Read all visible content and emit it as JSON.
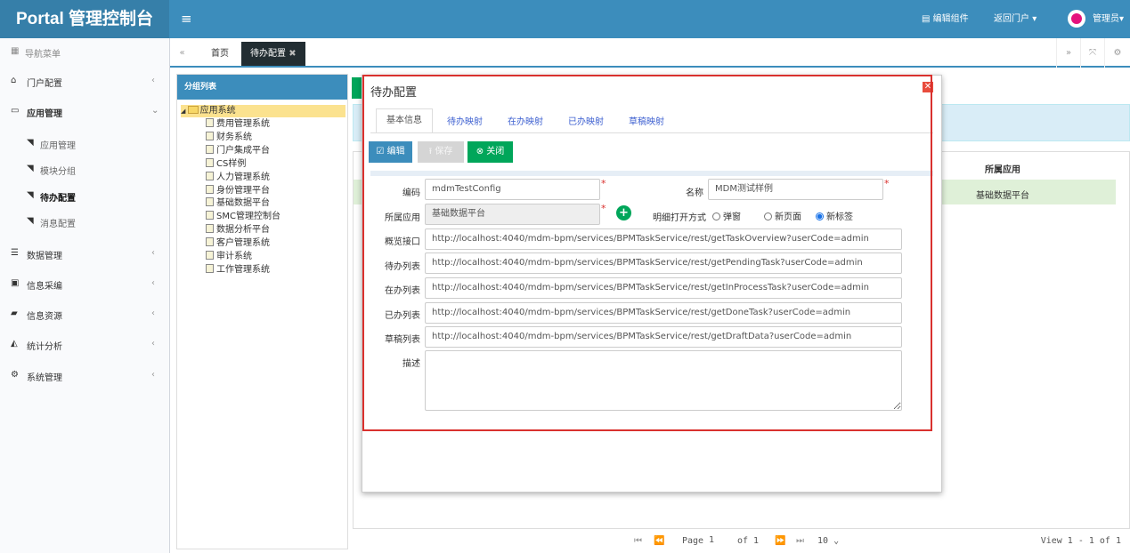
{
  "header": {
    "app_title": "Portal 管理控制台",
    "edit_widget": "编辑组件",
    "back_portal": "返回门户",
    "user": "管理员"
  },
  "sidebar": {
    "nav_title": "导航菜单",
    "items": [
      {
        "label": "门户配置"
      },
      {
        "label": "应用管理"
      },
      {
        "label": "应用管理"
      },
      {
        "label": "模块分组"
      },
      {
        "label": "待办配置"
      },
      {
        "label": "消息配置"
      },
      {
        "label": "数据管理"
      },
      {
        "label": "信息采编"
      },
      {
        "label": "信息资源"
      },
      {
        "label": "统计分析"
      },
      {
        "label": "系统管理"
      }
    ]
  },
  "tabs": {
    "home": "首页",
    "active": "待办配置"
  },
  "group_panel": {
    "title": "分组列表",
    "root": "应用系统",
    "children": [
      "费用管理系统",
      "财务系统",
      "门户集成平台",
      "CS样例",
      "人力管理系统",
      "身份管理平台",
      "基础数据平台",
      "SMC管理控制台",
      "数据分析平台",
      "客户管理系统",
      "审计系统",
      "工作管理系统"
    ]
  },
  "table": {
    "header_app": "所属应用",
    "row_app": "基础数据平台"
  },
  "pager": {
    "page_label": "Page",
    "page_value": "1",
    "of_label": "of 1",
    "page_size": "10",
    "view": "View 1 - 1 of 1"
  },
  "modal": {
    "title": "待办配置",
    "tabs": [
      "基本信息",
      "待办映射",
      "在办映射",
      "已办映射",
      "草稿映射"
    ],
    "buttons": {
      "edit": "编辑",
      "save": "保存",
      "close": "关闭"
    },
    "fields": {
      "code_label": "编码",
      "code_value": "mdmTestConfig",
      "name_label": "名称",
      "name_value": "MDM测试样例",
      "app_label": "所属应用",
      "app_value": "基础数据平台",
      "open_label": "明细打开方式",
      "open_options": [
        "弹窗",
        "新页面",
        "新标签"
      ],
      "overview_label": "概览接口",
      "overview_value": "http://localhost:4040/mdm-bpm/services/BPMTaskService/rest/getTaskOverview?userCode=admin",
      "pending_label": "待办列表",
      "pending_value": "http://localhost:4040/mdm-bpm/services/BPMTaskService/rest/getPendingTask?userCode=admin",
      "inprocess_label": "在办列表",
      "inprocess_value": "http://localhost:4040/mdm-bpm/services/BPMTaskService/rest/getInProcessTask?userCode=admin",
      "done_label": "已办列表",
      "done_value": "http://localhost:4040/mdm-bpm/services/BPMTaskService/rest/getDoneTask?userCode=admin",
      "draft_label": "草稿列表",
      "draft_value": "http://localhost:4040/mdm-bpm/services/BPMTaskService/rest/getDraftData?userCode=admin",
      "desc_label": "描述"
    }
  },
  "colors": {
    "primary": "#3c8dbc",
    "success": "#00a65a",
    "danger": "#d9312e"
  }
}
